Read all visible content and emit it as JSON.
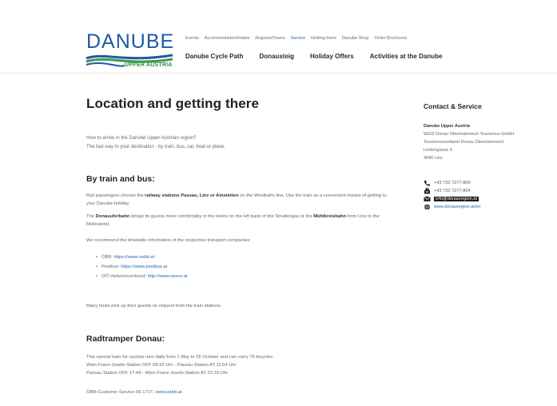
{
  "brand": {
    "name": "DANUBE",
    "subtitle": "UPPER AUSTRIA",
    "colors": {
      "blue": "#1f5aa6",
      "green": "#2a8a3e",
      "link": "#2a64b4"
    }
  },
  "topnav": [
    {
      "label": "Events",
      "active": false
    },
    {
      "label": "Accommodation/Hotels",
      "active": false
    },
    {
      "label": "Regions/Towns",
      "active": false
    },
    {
      "label": "Service",
      "active": true
    },
    {
      "label": "Getting there",
      "active": false
    },
    {
      "label": "Danube Shop",
      "active": false
    },
    {
      "label": "Order Brochures",
      "active": false
    }
  ],
  "mainnav": [
    "Danube Cycle Path",
    "Donausteig",
    "Holiday Offers",
    "Activities at the Danube"
  ],
  "page": {
    "title": "Location and getting there",
    "intro_line1": "How to arrive in the Danube Upper Austrian region?",
    "intro_line2": "The fast way to your destination - by train, bus, car, boat or plane."
  },
  "train": {
    "heading": "By train and bus:",
    "p1_a": "Rail passengers choose the ",
    "p1_b": "railway stations Passau, Linz or Amstetten",
    "p1_c": " on the Westbahn line. Use the train as a convenient means of getting to your Danube holiday.",
    "p2_a": "The ",
    "p2_b": "Donauuferbahn",
    "p2_c": " brings its guests more comfortably to the towns on the left bank of the Strudengau or the ",
    "p2_d": "Mühlkreisbahn",
    "p2_e": " from Linz to the Mühlviertel.",
    "p3": "We recommend the timetable information of the respective transport companies:",
    "links": [
      {
        "label": "ÖBB: ",
        "url": "https://www.oebb.at"
      },
      {
        "label": "Postbus: ",
        "url": "https://www.postbus.at"
      },
      {
        "label": "OÖ Verkehrsverbund: ",
        "url": "http://www.ooevv.at"
      }
    ],
    "p4": "Many hosts pick up their guests on request from the train stations."
  },
  "radtramper": {
    "heading": "Radtramper Donau:",
    "line1": "This special train for cyclists runs daily from 1 May to 26 October and can carry 75 bicycles:",
    "line2": "Wien Franz-Josefs-Station OFF 08:33 Uhr - Passau Station AT 11:54 Uhr",
    "line3": "Passau Station OFF 17:44 - Wien Franz-Josefs-Station AT 22:33 Uhr",
    "service_label": "ÖBB-Customer Service 05-1717, ",
    "service_link": "www.oebb.at"
  },
  "sidebar": {
    "title": "Contact & Service",
    "org_name": "Danube Upper Austria",
    "org_line1": "WGD Donau Oberösterreich Tourismus GmbH",
    "org_line2": "Tourismusverband Donau Oberösterreich",
    "org_line3": "Lindengasse 9",
    "org_line4": "4040 Linz",
    "phone": "+43 732 7277-800",
    "fax": "+43 732 7277-804",
    "email": "info@donauregion.at",
    "web": "www.donauregion.at/en"
  }
}
